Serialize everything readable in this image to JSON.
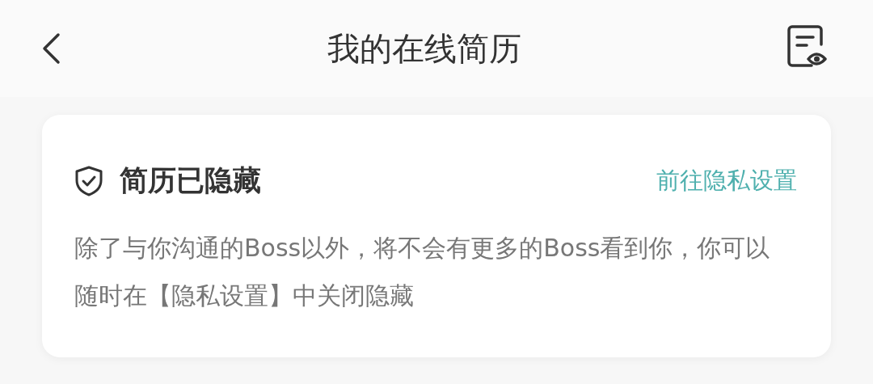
{
  "header": {
    "title": "我的在线简历"
  },
  "notice": {
    "title": "简历已隐藏",
    "link": "前往隐私设置",
    "text": "除了与你沟通的Boss以外，将不会有更多的Boss看到你，你可以随时在【隐私设置】中关闭隐藏"
  }
}
